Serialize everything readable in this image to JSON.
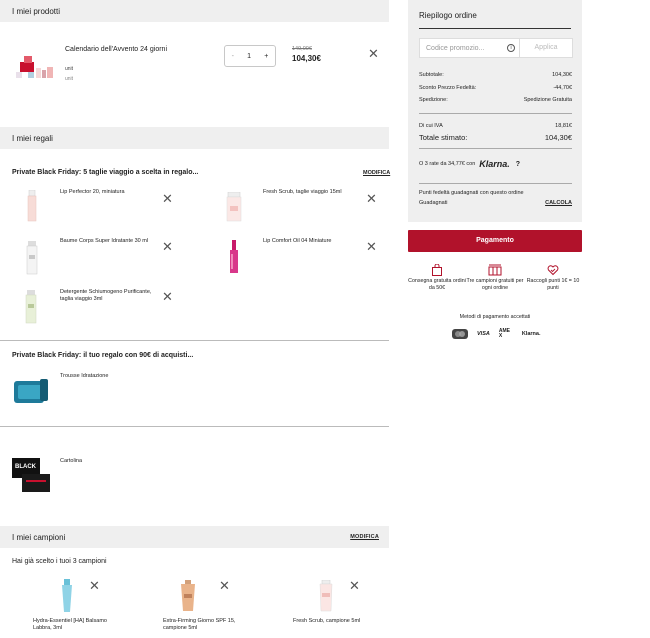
{
  "products": {
    "header": "I miei prodotti",
    "item": {
      "name": "Calendario dell'Avvento 24 giorni",
      "unit1": "unit",
      "unit2": "unit",
      "qty": "1",
      "minus": "-",
      "plus": "+",
      "old_price": "149,00€",
      "price": "104,30€"
    }
  },
  "gifts": {
    "header": "I miei regali",
    "group1": {
      "title": "Private Black Friday: 5 taglie viaggio a scelta in regalo...",
      "link": "MODIFICA",
      "items": [
        {
          "name": "Lip Perfector 20, miniatura"
        },
        {
          "name": "Fresh Scrub, taglie viaggio 15ml"
        },
        {
          "name": "Baume Corps Super Idratante 30 ml"
        },
        {
          "name": "Lip Comfort Oil 04 Miniature"
        },
        {
          "name": "Detergente Schiumogeno Purificante, taglia viaggio 3ml"
        }
      ]
    },
    "group2": {
      "title": "Private Black Friday: il tuo regalo con 90€ di acquisti...",
      "item": "Trousse Idratazione"
    },
    "group3": {
      "item": "Cartolina"
    }
  },
  "samples": {
    "header": "I miei campioni",
    "link": "MODIFICA",
    "subtitle": "Hai già scelto i tuoi 3 campioni",
    "items": [
      {
        "name": "Hydra-Essentiel [HA] Balsamo Labbra, 3ml"
      },
      {
        "name": "Extra-Firming Giorno SPF 15, campione 5ml"
      },
      {
        "name": "Fresh Scrub, campione 5ml"
      }
    ]
  },
  "summary": {
    "title": "Riepilogo ordine",
    "promo_placeholder": "Codice promozio...",
    "apply": "Applica",
    "subtotal_label": "Subtotale:",
    "subtotal": "104,30€",
    "discount_label": "Sconto Prezzo Fedeltà:",
    "discount": "-44,70€",
    "shipping_label": "Spedizione:",
    "shipping": "Spedizione Gratuita",
    "vat_label": "Di cui IVA",
    "vat": "18,81€",
    "total_label": "Totale stimato:",
    "total": "104,30€",
    "klarna_text": "O 3 rate da 34,77€ con",
    "klarna_brand": "Klarna.",
    "klarna_info": "?",
    "points_text": "Punti fedeltà guadagnati con questo ordine",
    "earned_label": "Guadagnati",
    "calc_link": "CALCOLA",
    "pay_button": "Pagamento"
  },
  "features": [
    {
      "text": "Consegna gratuita ordini da 50€"
    },
    {
      "text": "Tre campioni gratuiti per ogni ordine"
    },
    {
      "text": "Raccogli punti 1€ = 10 punti"
    }
  ],
  "payment": {
    "title": "Metodi di pagamento accettati",
    "methods": [
      "mastercard",
      "VISA",
      "AMEX",
      "Klarna."
    ]
  }
}
